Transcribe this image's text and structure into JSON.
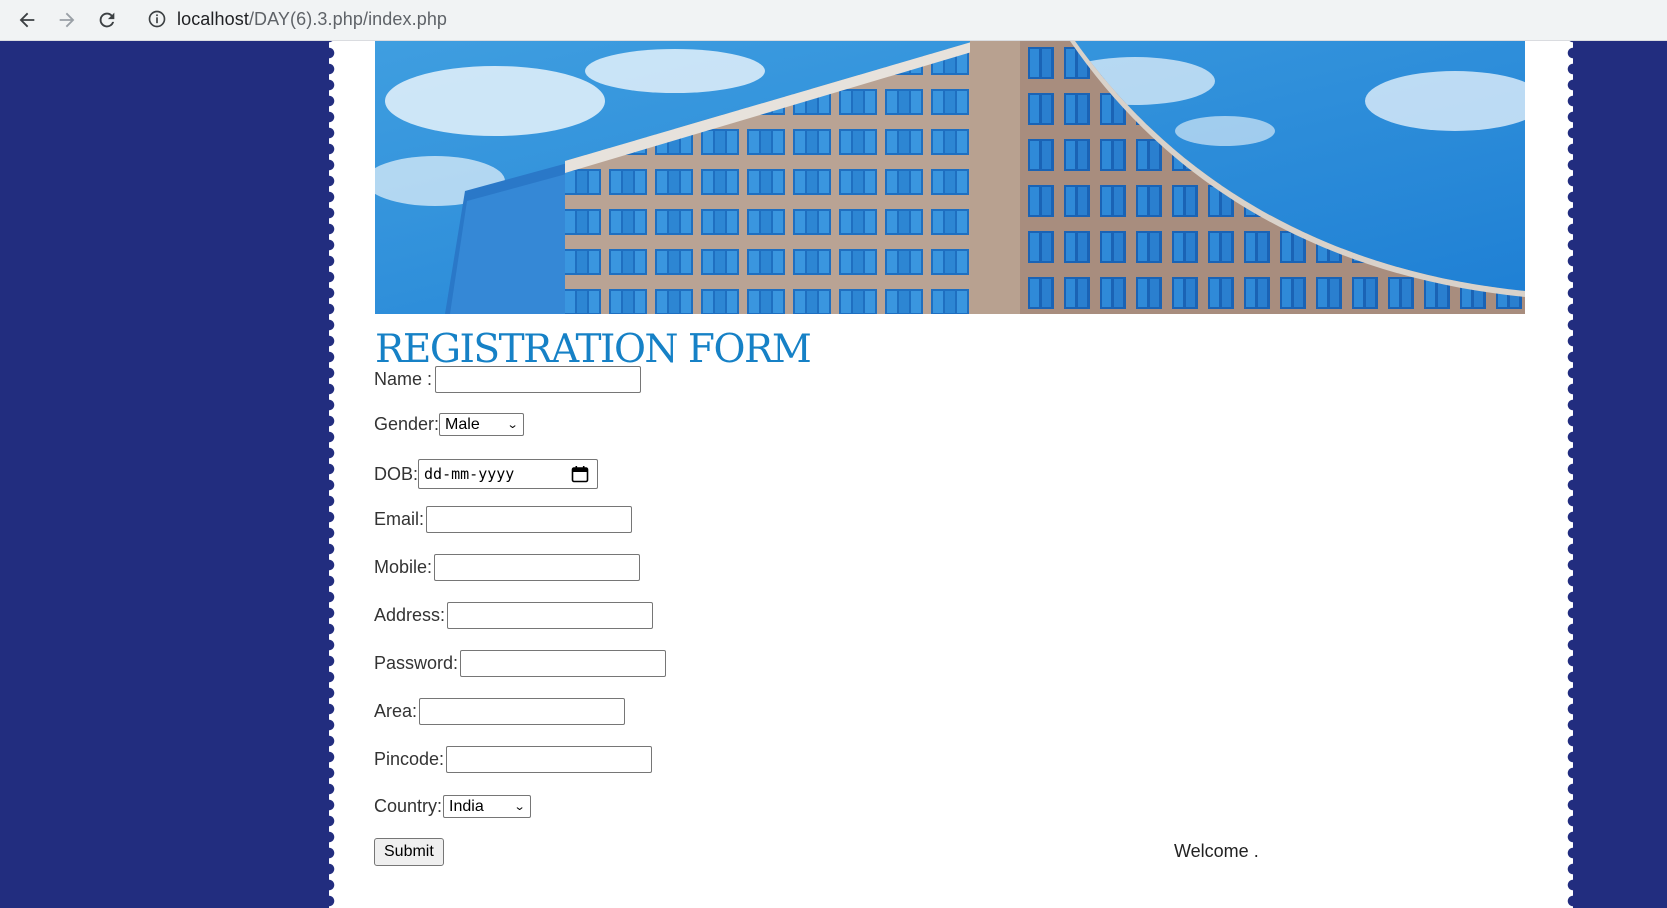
{
  "browser": {
    "url_host": "localhost",
    "url_path": "/DAY(6).3.php/index.php"
  },
  "page": {
    "title": "REGISTRATION FORM",
    "fields": {
      "name_label": "Name :",
      "gender_label": "Gender:",
      "gender_value": "Male",
      "dob_label": "DOB:",
      "dob_placeholder": "dd-mm-yyyy",
      "email_label": "Email:",
      "mobile_label": "Mobile:",
      "address_label": "Address:",
      "password_label": "Password:",
      "area_label": "Area:",
      "pincode_label": "Pincode:",
      "country_label": "Country:",
      "country_value": "India"
    },
    "submit_label": "Submit",
    "welcome_text": "Welcome ."
  },
  "colors": {
    "background": "#222d7f",
    "title": "#1681c6"
  },
  "icons": [
    "back-arrow-icon",
    "forward-arrow-icon",
    "reload-icon",
    "info-icon",
    "calendar-icon",
    "chevron-down-icon"
  ]
}
